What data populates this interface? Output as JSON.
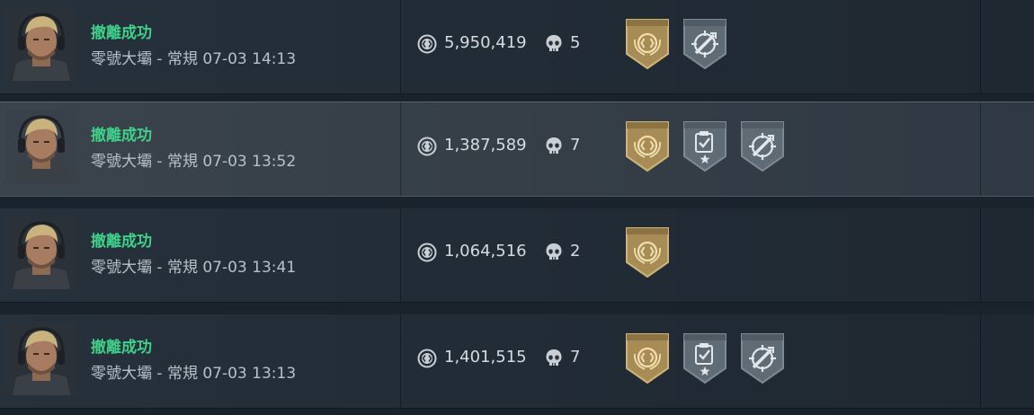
{
  "records": [
    {
      "status": "撤離成功",
      "map_mode_time": "零號大壩 - 常規 07-03 14:13",
      "money": "5,950,419",
      "kills": "5",
      "badges": [
        "gold-emblem-badge",
        "targeting-badge"
      ]
    },
    {
      "status": "撤離成功",
      "map_mode_time": "零號大壩 - 常規 07-03 13:52",
      "money": "1,387,589",
      "kills": "7",
      "badges": [
        "gold-emblem-badge",
        "checklist-badge",
        "targeting-badge"
      ]
    },
    {
      "status": "撤離成功",
      "map_mode_time": "零號大壩 - 常規 07-03 13:41",
      "money": "1,064,516",
      "kills": "2",
      "badges": [
        "gold-emblem-badge"
      ]
    },
    {
      "status": "撤離成功",
      "map_mode_time": "零號大壩 - 常規 07-03 13:13",
      "money": "1,401,515",
      "kills": "7",
      "badges": [
        "gold-emblem-badge",
        "checklist-badge",
        "targeting-badge"
      ]
    }
  ],
  "colors": {
    "success": "#3fd08a",
    "gold_badge": "#a88c56",
    "gray_badge": "#5f6b75"
  },
  "icons": {
    "currency": "coin-icon",
    "kills": "skull-icon",
    "avatar": "operator-portrait"
  }
}
